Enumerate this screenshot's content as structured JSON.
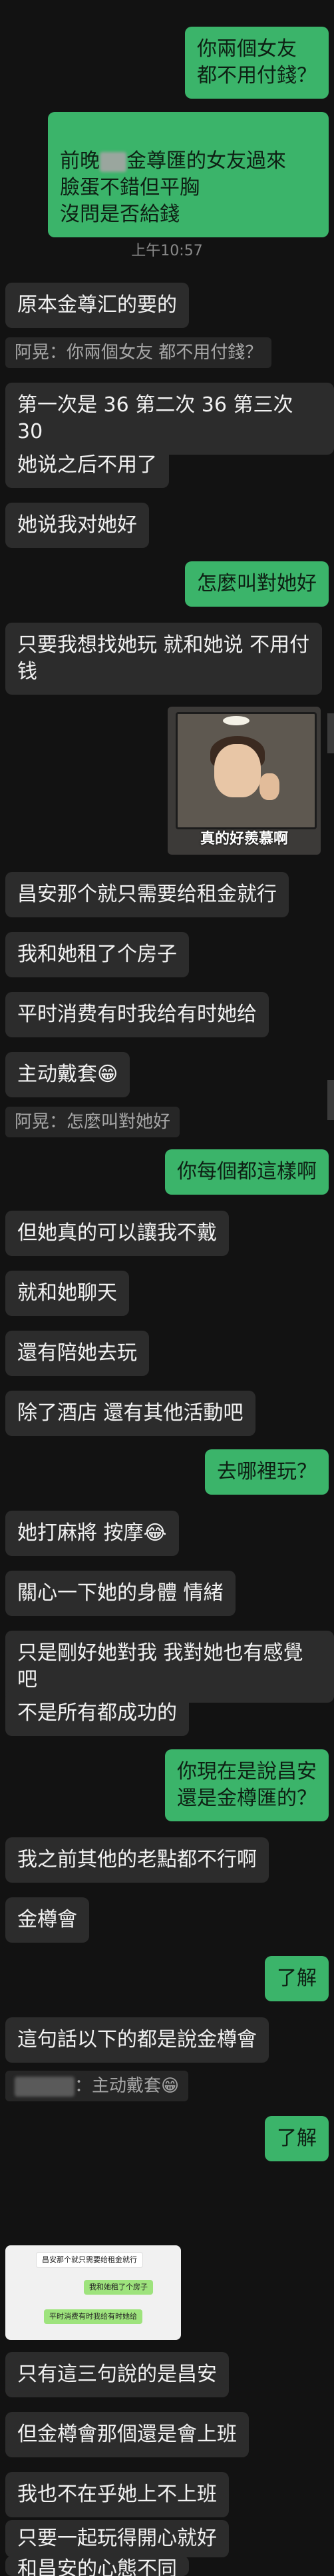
{
  "messages": {
    "m1": "你兩個女友\n都不用付錢？",
    "m2a": "前晚",
    "m2b": "金尊匯的女友過來\n臉蛋不錯但平胸\n沒問是否給錢",
    "time": "上午10:57",
    "m3": "原本金尊汇的要的",
    "q1": "阿晃：你兩個女友 都不用付錢？",
    "m4": "第一次是 36 第二次 36 第三次 30",
    "m5": "她说之后不用了",
    "m6": "她说我对她好",
    "m7": "怎麼叫對她好",
    "m8": "只要我想找她玩 就和她说 不用付\n钱",
    "sticker_caption": "真的好羨慕啊",
    "m9": "昌安那个就只需要给租金就行",
    "m10": "我和她租了个房子",
    "m11": "平时消费有时我给有时她给",
    "m12": "主动戴套😁",
    "q2": "阿晃：怎麼叫對她好",
    "m13": "你每個都這樣啊",
    "m14": "但她真的可以讓我不戴",
    "m15": "就和她聊天",
    "m16": "還有陪她去玩",
    "m17": "除了酒店 還有其他活動吧",
    "m18": "去哪裡玩？",
    "m19": "她打麻將 按摩😂",
    "m20": "關心一下她的身體 情緒",
    "m21": "只是剛好她對我 我對她也有感覺吧",
    "m22": "不是所有都成功的",
    "m23": "你現在是說昌安\n還是金樽匯的？",
    "m24": "我之前其他的老點都不行啊",
    "m25": "金樽會",
    "m26": "了解",
    "m27": "這句話以下的都是說金樽會",
    "q3": "：主动戴套😁",
    "m28": "了解",
    "m29": "只有這三句說的是昌安",
    "m30": "但金樽會那個還是會上班",
    "m31": "我也不在乎她上不上班",
    "m32": "只要一起玩得開心就好",
    "m33": "和昌安的心態不同"
  },
  "thumbnail": {
    "t1": "昌安那个就只需要给租金就行",
    "t2": "我和她租了个房子",
    "t3": "平时消费有时我给有时她给"
  }
}
